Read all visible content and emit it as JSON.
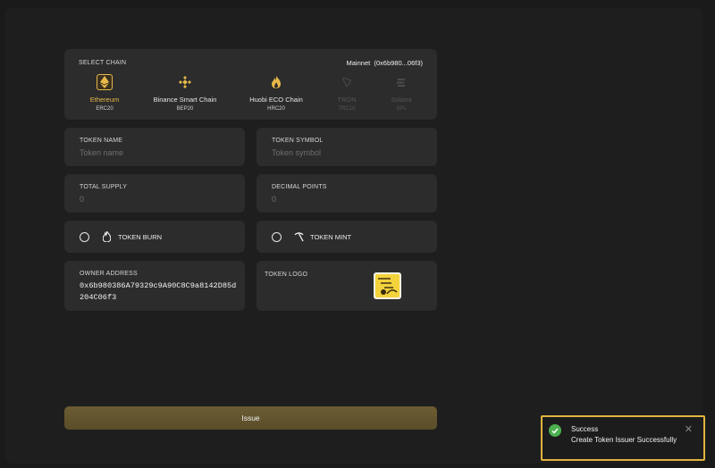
{
  "chain_panel": {
    "label": "SELECT CHAIN",
    "network": "Mainnet",
    "address_short": "(0x6b980...06f3)",
    "chains": [
      {
        "name": "Ethereum",
        "standard": "ERC20",
        "icon": "ethereum-icon",
        "state": "active"
      },
      {
        "name": "Binance Smart Chain",
        "standard": "BEP20",
        "icon": "binance-icon",
        "state": "normal"
      },
      {
        "name": "Huobi ECO Chain",
        "standard": "HRC20",
        "icon": "huobi-flame-icon",
        "state": "normal"
      },
      {
        "name": "TRON",
        "standard": "TRC10",
        "icon": "tron-icon",
        "state": "disabled"
      },
      {
        "name": "Solana",
        "standard": "SPL",
        "icon": "solana-icon",
        "state": "disabled"
      }
    ]
  },
  "fields": {
    "token_name": {
      "label": "TOKEN NAME",
      "placeholder": "Token name"
    },
    "token_symbol": {
      "label": "TOKEN SYMBOL",
      "placeholder": "Token symbol"
    },
    "total_supply": {
      "label": "TOTAL SUPPLY",
      "placeholder": "0"
    },
    "decimal_points": {
      "label": "DECIMAL POINTS",
      "placeholder": "0"
    }
  },
  "toggles": {
    "burn": {
      "label": "TOKEN BURN",
      "icon": "flame-icon",
      "checked": false
    },
    "mint": {
      "label": "TOKEN MINT",
      "icon": "pickaxe-icon",
      "checked": false
    }
  },
  "owner": {
    "label": "OWNER ADDRESS",
    "address": "0x6b980386A79329c9A90C8C9a8142D85d204C06f3"
  },
  "logo": {
    "label": "TOKEN LOGO"
  },
  "issue_button": {
    "label": "Issue"
  },
  "toast": {
    "title": "Success",
    "message": "Create Token Issuer Successfully",
    "close_icon": "close-icon"
  },
  "colors": {
    "accent": "#e8b949",
    "panel": "#2c2c2c",
    "success": "#4caf50"
  }
}
